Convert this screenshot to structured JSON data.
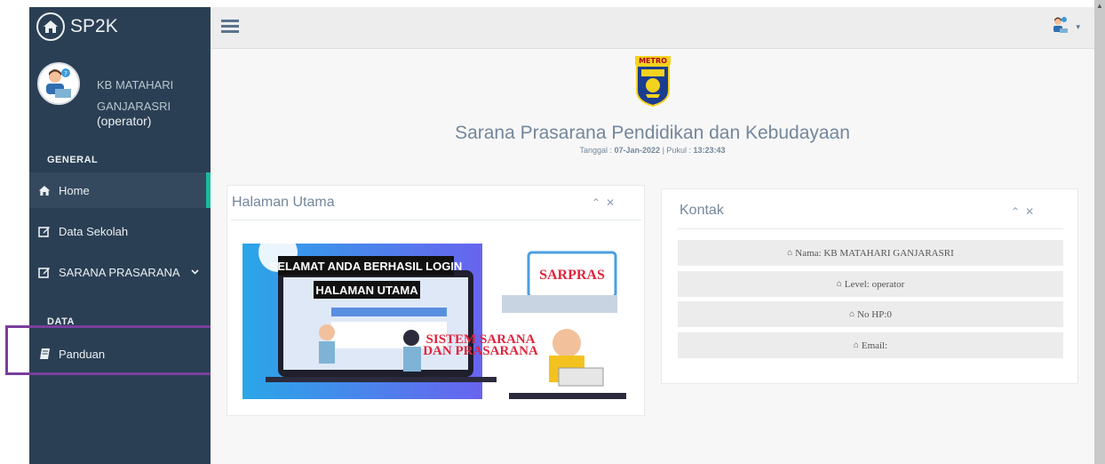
{
  "app": {
    "brand": "SP2K"
  },
  "profile": {
    "name": "KB MATAHARI GANJARASRI",
    "role": "(operator)"
  },
  "sidebar": {
    "section_general": "GENERAL",
    "section_data": "DATA",
    "items": [
      {
        "label": "Home",
        "icon": "home-icon"
      },
      {
        "label": "Data Sekolah",
        "icon": "edit-icon"
      },
      {
        "label": "SARANA PRASARANA",
        "icon": "edit-icon"
      },
      {
        "label": "Panduan",
        "icon": "book-icon"
      }
    ]
  },
  "header": {
    "title": "Sarana Prasarana Pendidikan dan Kebudayaan",
    "date_label": "Tanggal :",
    "date": "07-Jan-2022",
    "time_label": "| Pukul :",
    "time": "13:23:43",
    "logo_text": "METRO"
  },
  "panels": {
    "main": {
      "title": "Halaman Utama",
      "banner": {
        "line1": "SELAMAT ANDA BERHASIL LOGIN",
        "line2": "HALAMAN UTAMA",
        "sarpras": "SARPRAS",
        "sistem1": "SISTEM SARANA",
        "sistem2": "DAN PRASARANA"
      }
    },
    "contact": {
      "title": "Kontak",
      "rows": [
        "Nama: KB MATAHARI GANJARASRI",
        "Level: operator",
        "No HP:0",
        "Email:"
      ]
    }
  },
  "colors": {
    "sidebar": "#2a3f54",
    "accent": "#1abb9c",
    "highlight": "#7a3e9d",
    "text": "#73879c"
  }
}
